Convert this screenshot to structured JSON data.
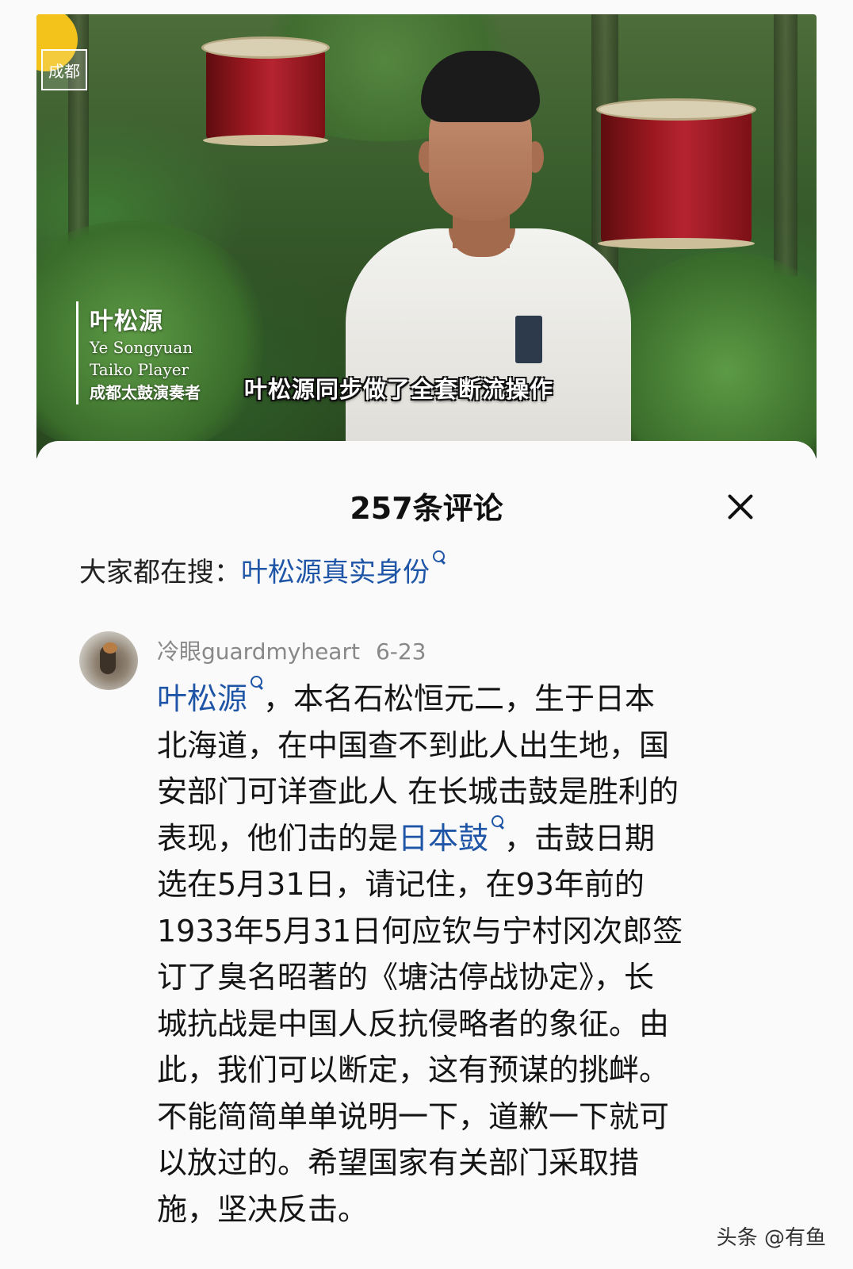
{
  "video": {
    "logo_text": "成都",
    "caption_name": "叶松源",
    "caption_en_name": "Ye Songyuan",
    "caption_en_role": "Taiko Player",
    "caption_cn_role": "成都太鼓演奏者",
    "subtitle": "叶松源同步做了全套断流操作"
  },
  "panel": {
    "title": "257条评论",
    "close_icon": "close-icon"
  },
  "hot_search": {
    "prefix": "大家都在搜：",
    "link": "叶松源真实身份"
  },
  "comment": {
    "author": "冷眼guardmyheart",
    "date": "6-23",
    "lines": [
      {
        "link": "叶松源",
        "text": "，本名石松恒元二，生于日本"
      },
      {
        "text": "北海道，在中国查不到此人出生地，国"
      },
      {
        "text": "安部门可详查此人 在长城击鼓是胜利的"
      },
      {
        "pre": "表现，他们击的是",
        "link": "日本鼓",
        "text": "，击鼓日期"
      },
      {
        "text": "选在5月31日，请记住，在93年前的"
      },
      {
        "text": "1933年5月31日何应钦与宁村冈次郎签"
      },
      {
        "text": "订了臭名昭著的《塘沽停战协定》，长"
      },
      {
        "text": "城抗战是中国人反抗侵略者的象征。由"
      },
      {
        "text": "此，我们可以断定，这有预谋的挑衅。"
      },
      {
        "text": "不能简简单单说明一下，道歉一下就可"
      },
      {
        "text": "以放过的。希望国家有关部门采取措"
      },
      {
        "text": "施，坚决反击。"
      }
    ]
  },
  "watermark": "头条 @有鱼",
  "colors": {
    "link": "#1f55a6",
    "text": "#141414",
    "meta": "#888888",
    "background": "#fafafa"
  }
}
